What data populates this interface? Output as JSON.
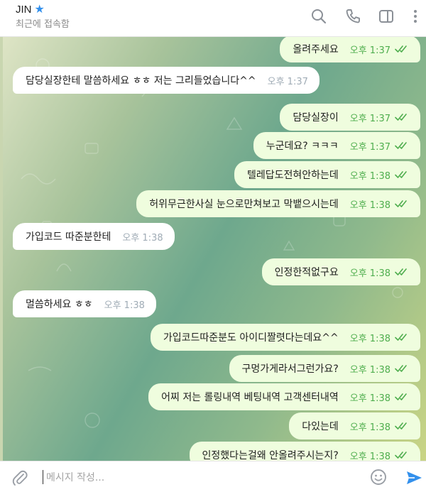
{
  "header": {
    "name": "JIN",
    "status": "최근에 접속함",
    "icons": [
      "search-icon",
      "phone-icon",
      "sidebar-toggle-icon",
      "more-vertical-icon"
    ]
  },
  "messages": [
    {
      "dir": "out",
      "text": "올려주세요",
      "time": "오후 1:37",
      "read": true
    },
    {
      "dir": "in",
      "text": "담당실장한테 말씀하세요 ㅎㅎ 저는 그리들었습니다^^",
      "time": "오후 1:37"
    },
    {
      "dir": "out",
      "text": "담당실장이",
      "time": "오후 1:37",
      "read": true
    },
    {
      "dir": "out",
      "text": "누군데요? ㅋㅋㅋ",
      "time": "오후 1:37",
      "read": true
    },
    {
      "dir": "out",
      "text": "텔레답도전혀안하는데",
      "time": "오후 1:38",
      "read": true
    },
    {
      "dir": "out",
      "text": "허위무근한사실 눈으로만쳐보고 막뱉으시는데",
      "time": "오후 1:38",
      "read": true
    },
    {
      "dir": "in",
      "text": "가입코드 따준분한테",
      "time": "오후 1:38"
    },
    {
      "dir": "out",
      "text": "인정한적없구요",
      "time": "오후 1:38",
      "read": true
    },
    {
      "dir": "in",
      "text": "멀씀하세요 ㅎㅎ",
      "time": "오후 1:38"
    },
    {
      "dir": "out",
      "text": "가입코드따준분도 아이디짤렷다는데요^^",
      "time": "오후 1:38",
      "read": true
    },
    {
      "dir": "out",
      "text": "구멍가게라서그런가요?",
      "time": "오후 1:38",
      "read": true
    },
    {
      "dir": "out",
      "text": "어찌 저는 롤링내역 베팅내역 고객센터내역",
      "time": "오후 1:38",
      "read": true
    },
    {
      "dir": "out",
      "text": "다있는데",
      "time": "오후 1:38",
      "read": true
    },
    {
      "dir": "out",
      "text": "인정했다는걸왜 안올려주시는지?",
      "time": "오후 1:38",
      "read": true
    }
  ],
  "composer": {
    "placeholder": "메시지 작성...",
    "icons": [
      "attach-icon",
      "emoji-icon",
      "send-icon"
    ]
  },
  "colors": {
    "outgoing_bubble": "#effdde",
    "incoming_bubble": "#ffffff",
    "accent": "#3390ec",
    "read_check": "#4fae4e"
  }
}
